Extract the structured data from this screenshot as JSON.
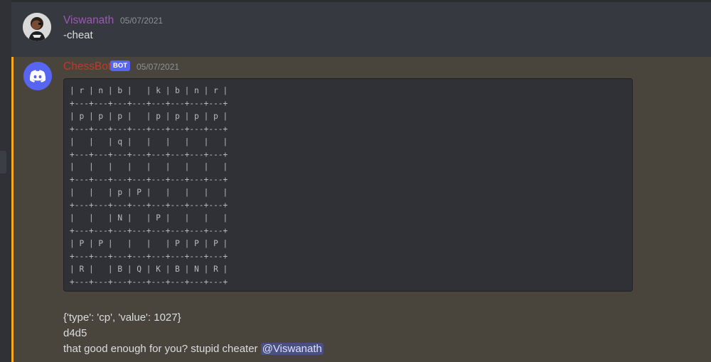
{
  "messages": [
    {
      "username": "Viswanath",
      "timestamp": "05/07/2021",
      "text": "-cheat",
      "username_color": "#9b59b6"
    },
    {
      "username": "ChessBot",
      "badge": "BOT",
      "timestamp": "05/07/2021",
      "username_color": "#c0392b",
      "highlight_color": "#faa81a",
      "code": "| r | n | b |   | k | b | n | r |\n+---+---+---+---+---+---+---+---+\n| p | p | p |   | p | p | p | p |\n+---+---+---+---+---+---+---+---+\n|   |   | q |   |   |   |   |   |\n+---+---+---+---+---+---+---+---+\n|   |   |   |   |   |   |   |   |\n+---+---+---+---+---+---+---+---+\n|   |   | p | P |   |   |   |   |\n+---+---+---+---+---+---+---+---+\n|   |   | N |   | P |   |   |   |\n+---+---+---+---+---+---+---+---+\n| P | P |   |   |   | P | P | P |\n+---+---+---+---+---+---+---+---+\n| R |   | B | Q | K | B | N | R |\n+---+---+---+---+---+---+---+---+",
      "lines": [
        "{'type': 'cp', 'value': 1027}",
        "d4d5",
        "that good enough for you? stupid cheater "
      ],
      "mention": "@Viswanath"
    }
  ]
}
